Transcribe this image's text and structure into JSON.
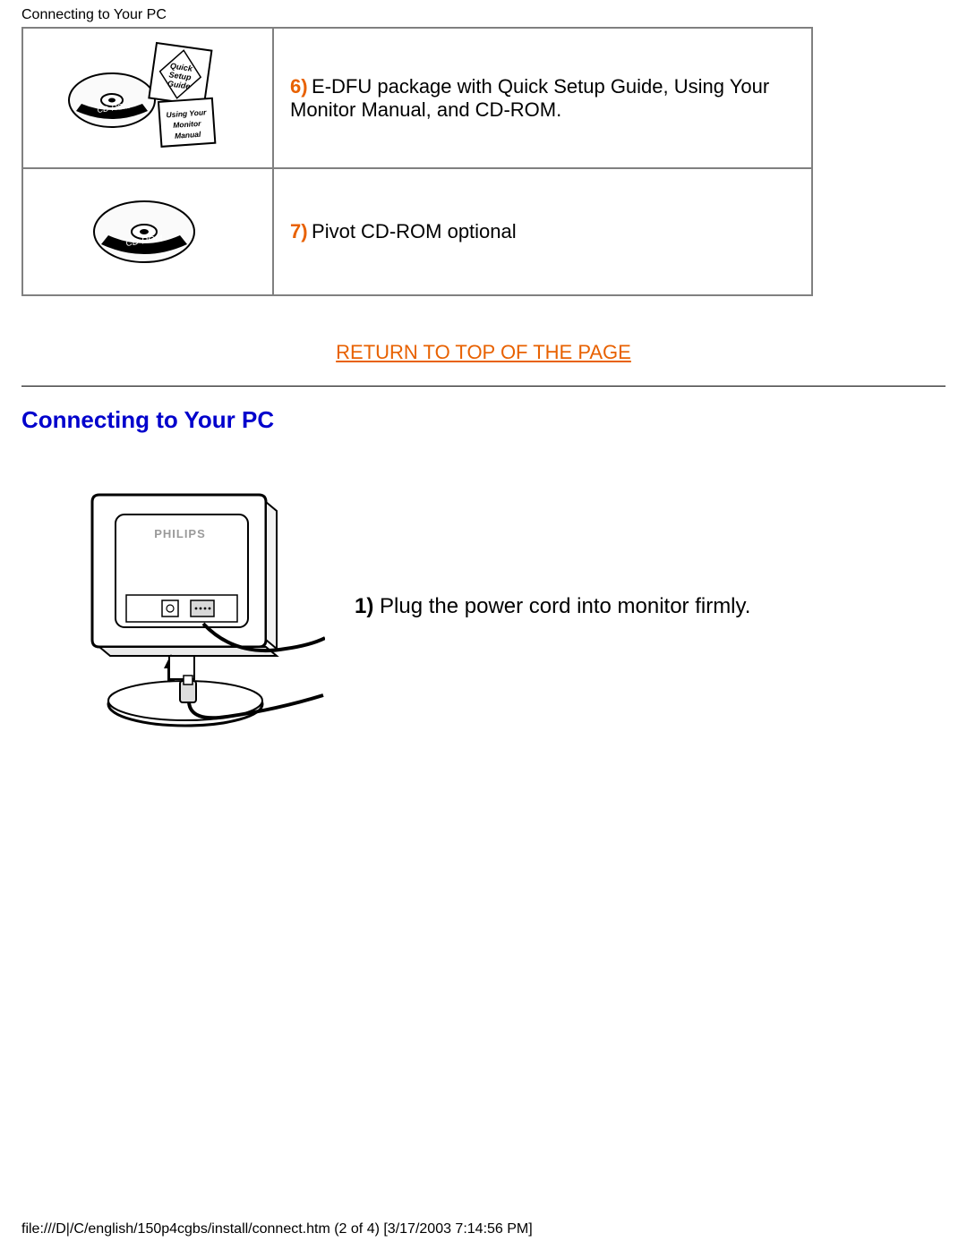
{
  "header": {
    "title": "Connecting to Your PC"
  },
  "items": [
    {
      "num": "6)",
      "desc": "E-DFU package with Quick Setup Guide, Using Your Monitor Manual, and CD-ROM."
    },
    {
      "num": "7)",
      "desc": "Pivot CD-ROM optional"
    }
  ],
  "return_link": "RETURN TO TOP OF THE PAGE",
  "section_heading": "Connecting to Your PC",
  "step": {
    "num": "1)",
    "text": "Plug the power cord into monitor firmly."
  },
  "footer": "file:///D|/C/english/150p4cgbs/install/connect.htm (2 of 4) [3/17/2003 7:14:56 PM]"
}
